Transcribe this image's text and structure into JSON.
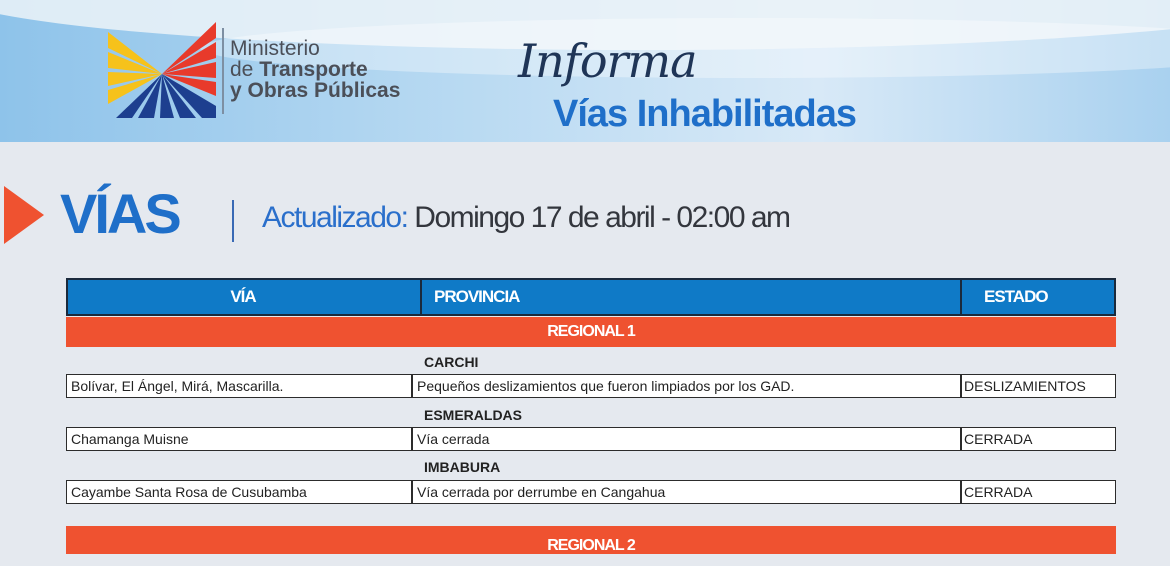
{
  "header": {
    "ministry_line1": "Ministerio",
    "ministry_line2_prefix": "de ",
    "ministry_line2_bold": "Transporte",
    "ministry_line3": "y Obras Públicas",
    "informa": "Informa",
    "subtitle": "Vías Inhabilitadas"
  },
  "title": {
    "main": "VÍAS",
    "updated_label": "Actualizado:",
    "updated_value": " Domingo 17 de abril  -  02:00 am"
  },
  "table": {
    "columns": [
      "VÍA",
      "PROVINCIA",
      "ESTADO"
    ],
    "regionals": [
      "REGIONAL 1",
      "REGIONAL 2"
    ],
    "provinces": [
      "CARCHI",
      "ESMERALDAS",
      "IMBABURA"
    ],
    "rows": [
      {
        "via": "Bolívar, El Ángel, Mirá, Mascarilla.",
        "provincia": "Pequeños deslizamientos que fueron limpiados por los GAD.",
        "estado": "DESLIZAMIENTOS"
      },
      {
        "via": "Chamanga Muisne",
        "provincia": "Vía cerrada",
        "estado": "CERRADA"
      },
      {
        "via": "Cayambe Santa Rosa de Cusubamba",
        "provincia": " Vía cerrada por derrumbe en Cangahua",
        "estado": "CERRADA"
      }
    ]
  },
  "colors": {
    "accent_blue": "#1f6fc9",
    "header_blue": "#0f7ac7",
    "regional_orange": "#ef5230"
  },
  "icons": [
    "ministry-logo-icon",
    "arrow-triangle-icon"
  ]
}
